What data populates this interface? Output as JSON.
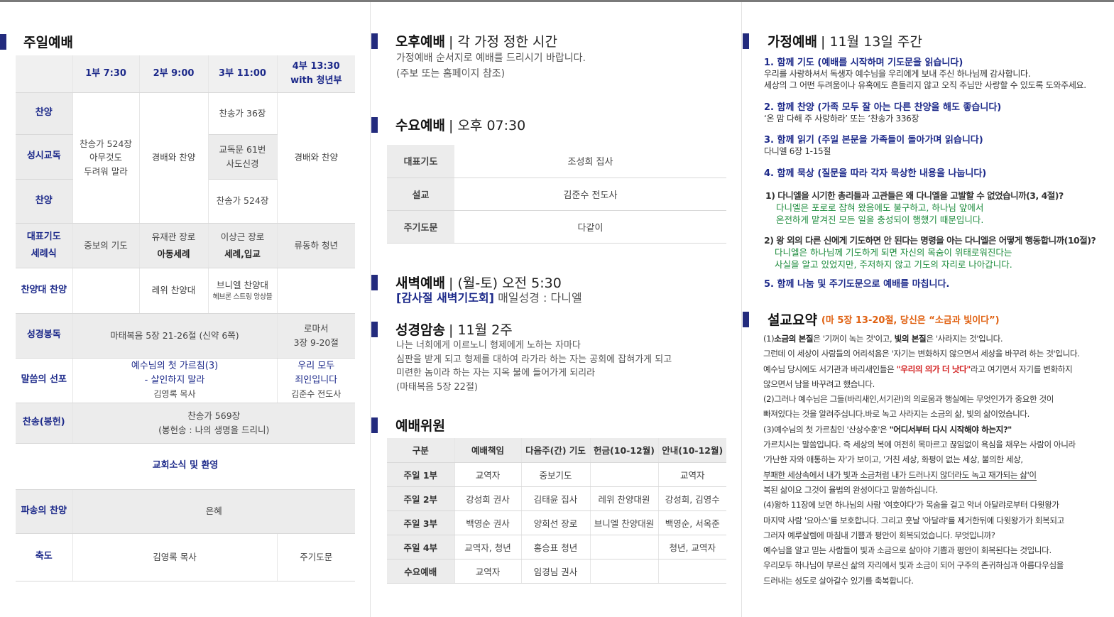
{
  "col1": {
    "title": "주일예배",
    "headers": [
      "1부 7:30",
      "2부 9:00",
      "3부 11:00",
      "4부 13:30",
      "with 청년부"
    ],
    "rows": {
      "praise1": "찬양",
      "catechism": "성시교독",
      "praise2": "찬양",
      "s1_merged": [
        "찬송가 524장",
        "아무것도",
        "두려워 말라"
      ],
      "s2_merged": "경배와 찬양",
      "s3_praise1": "찬송가 36장",
      "s3_catechism": [
        "교독문 61번",
        "사도신경"
      ],
      "s3_praise2": "찬송가 524장",
      "s4_merged": "경배와 찬양",
      "prayer_label": [
        "대표기도",
        "세례식"
      ],
      "prayer_s1": "중보의 기도",
      "prayer_s2": [
        "유재관 장로",
        "아동세례"
      ],
      "prayer_s3": [
        "이상근 장로",
        "세례,입교"
      ],
      "prayer_s4": "류동하 청년",
      "choir_label": "찬양대 찬양",
      "choir_s2": "레위 찬양대",
      "choir_s3": [
        "브니엘 찬양대",
        "헤브론 스트링 앙상블"
      ],
      "reading_label": "성경봉독",
      "reading_main": "마태복음 5장 21-26절 (신약 6쪽)",
      "reading_s4": [
        "로마서",
        "3장 9-20절"
      ],
      "sermon_label": "말씀의 선포",
      "sermon_main": [
        "예수님의 첫 가르침(3)",
        "- 살인하지 말라",
        "김영록 목사"
      ],
      "sermon_s4": [
        "우리 모두",
        "죄인입니다",
        "김준수 전도사"
      ],
      "offering_label": "찬송(봉헌)",
      "offering_main": [
        "찬송가 569장",
        "(봉헌송 : 나의 생명을 드리니)"
      ],
      "news": "교회소식 및 환영",
      "sending_label": "파송의 찬양",
      "sending_main": "은혜",
      "blessing_label": "축도",
      "blessing_main": "김영록 목사",
      "blessing_s4": "주기도문"
    }
  },
  "col2": {
    "afternoon": {
      "title": "오후예배",
      "sub": "| 각 가정 정한 시간",
      "lines": [
        "가정예배 순서지로 예배를 드리시기 바랍니다.",
        "(주보 또는 홈페이지 참조)"
      ]
    },
    "wednesday": {
      "title": "수요예배",
      "sub": "| 오후 07:30",
      "rows": [
        [
          "대표기도",
          "조성희 집사"
        ],
        [
          "설교",
          "김준수 전도사"
        ],
        [
          "주기도문",
          "다같이"
        ]
      ]
    },
    "dawn": {
      "title": "새벽예배",
      "sub": "| (월-토) 오전 5:30",
      "highlight": "[감사절 새벽기도회]",
      "rest": "매일성경 : 다니엘"
    },
    "memory": {
      "title": "성경암송",
      "sub": "| 11월 2주",
      "lines": [
        "나는 너희에게 이르노니 형제에게 노하는 자마다",
        "심판을 받게 되고 형제를 대하여 라가라 하는 자는 공회에 잡혀가게 되고",
        "미련한 놈이라 하는 자는 지옥 불에 들어가게 되리라",
        "(마태복음 5장 22절)"
      ]
    },
    "committee": {
      "title": "예배위원",
      "headers": [
        "구분",
        "예배책임",
        "다음주(간) 기도",
        "헌금(10-12월)",
        "안내(10-12월)"
      ],
      "rows": [
        [
          "주일 1부",
          "교역자",
          "중보기도",
          "",
          "교역자"
        ],
        [
          "주일 2부",
          "강성희 권사",
          "김태윤 집사",
          "레위 찬양대원",
          "강성희, 김영수"
        ],
        [
          "주일 3부",
          "백영순 권사",
          "양희선 장로",
          "브니엘 찬양대원",
          "백영순, 서옥준"
        ],
        [
          "주일 4부",
          "교역자, 청년",
          "홍승표 청년",
          "",
          "청년, 교역자"
        ],
        [
          "수요예배",
          "교역자",
          "임경님 권사",
          "",
          ""
        ]
      ]
    }
  },
  "col3": {
    "family": {
      "title": "가정예배",
      "sub": "| 11월 13일 주간",
      "s1_head": "1. 함께 기도 (예배를 시작하며 기도문을 읽습니다)",
      "s1_lines": [
        "우리를 사랑하셔서 독생자 예수님을 우리에게 보내 주신 하나님께 감사합니다.",
        "세상의 그 어떤 두려움이나 유혹에도 흔들리지 않고 오직 주님만 사랑할 수 있도록 도와주세요."
      ],
      "s2_head": "2. 함께 찬양 (가족 모두 잘 아는 다른 찬양을 해도 좋습니다)",
      "s2_line": "‘온 맘 다해 주 사랑하라’ 또는 ‘찬송가 336장",
      "s3_head": "3. 함께 읽기 (주일 본문을 가족들이 돌아가며 읽습니다)",
      "s3_line": "다니엘 6장 1-15절",
      "s4_head": "4. 함께 묵상 (질문을 따라 각자 묵상한 내용을 나눕니다)",
      "q1": "1) 다니엘을 시기한 총리들과 고관들은 왜 다니엘을 고발할 수 없었습니까(3, 4절)?",
      "a1": [
        "다니엘은 포로로 잡혀 왔음에도 불구하고, 하나님 앞에서",
        "온전하게 맡겨진 모든 일을 충성되이 행했기 때문입니다."
      ],
      "q2": "2) 왕 외의 다른 신에게 기도하면 안 된다는 명령을 아는 다니엘은 어떻게 행동합니까(10절)?",
      "a2": [
        "다니엘은 하나님께 기도하게 되면 자신의 목숨이 위태로워진다는",
        "사실을 알고 있었지만, 주저하지 않고 기도의 자리로 나아갑니다."
      ],
      "s5_head": "5. 함께 나눔 및 주기도문으로 예배를 마칩니다."
    },
    "sermon": {
      "title": "설교요약",
      "ref": "(마 5장 13-20절, 당신은 “소금과 빛이다”)",
      "l1a": "(1)",
      "l1b": "소금의 본질",
      "l1c": "은 '기꺼이 녹는 것'이고, ",
      "l1d": "빛의 본질",
      "l1e": "은 '사라지는 것'입니다.",
      "l2": "그런데 이 세상이 사람들의 어리석음은 '자기는 변화하지 않으면서 세상을 바꾸려 하는 것'입니다.",
      "l3a": "예수님 당시에도 서기관과 바리새인들은 ",
      "l3b": "\"우리의 의가 더 낫다\"",
      "l3c": "라고 여기면서 자기를 변화하지",
      "l4": "않으면서 남을 바꾸려고 했습니다.",
      "l5": "(2)그러나 예수님은 그들(바리새인,서기관)의 의로움과 행실에는 무엇인가가 중요한 것이",
      "l6": "빠져있다는 것을 알려주십니다.바로 녹고 사라지는 소금의 삶, 빛의 삶이었습니다.",
      "l7a": "(3)예수님의 첫 가르침인 '산상수훈'은 ",
      "l7b": "\"어디서부터 다시 시작해야 하는지?\"",
      "l8": "가르치시는 말씀입니다. 즉 세상의 복에 여전히 목마르고 끊임없이 욕심을 채우는 사람이 아니라",
      "l9": "'가난한 자와 애통하는 자'가 보이고, '거친 세상, 화평이 없는 세상, 불의한 세상,",
      "l10": "부패한 세상속에서 내가 빛과 소금처럼 내가 드러나지 않더라도 녹고 재가되는 삶'이",
      "l11": "복된 삶이요 그것이 율법의 완성이다고 말씀하십니다.",
      "l12": "(4)왕하 11장에 보면 하나님의 사람 '여호야다'가 목숨을 걸고 악녀 아달랴로부터  다윗왕가",
      "l13": "마지막 사람 '요아스'를 보호합니다. 그리고 훗날 '아달랴'를 제거한뒤에 다윗왕가가 회복되고",
      "l14": "그러자 예루살렘에 마침내 기쁨과 평안이 회복되었습니다. 무엇입니까?",
      "l15": "예수님을 알고 믿는 사람들이 빛과 소금으로 살아야 기쁨과 평안이 회복된다는 것입니다.",
      "l16": "우리모두 하나님이 부르신 삶의 자리에서 빛과 소금이 되어 구주의 존귀하심과 아름다우심을",
      "l17": "드러내는 성도로 살아갈수 있기를 축복합니다."
    }
  },
  "colors": {
    "accent_navy": "#232b7d",
    "label_blue": "#1d2a8a",
    "answer_green": "#1a8a3a",
    "ref_orange": "#e06010",
    "quote_red": "#d21e1e"
  }
}
